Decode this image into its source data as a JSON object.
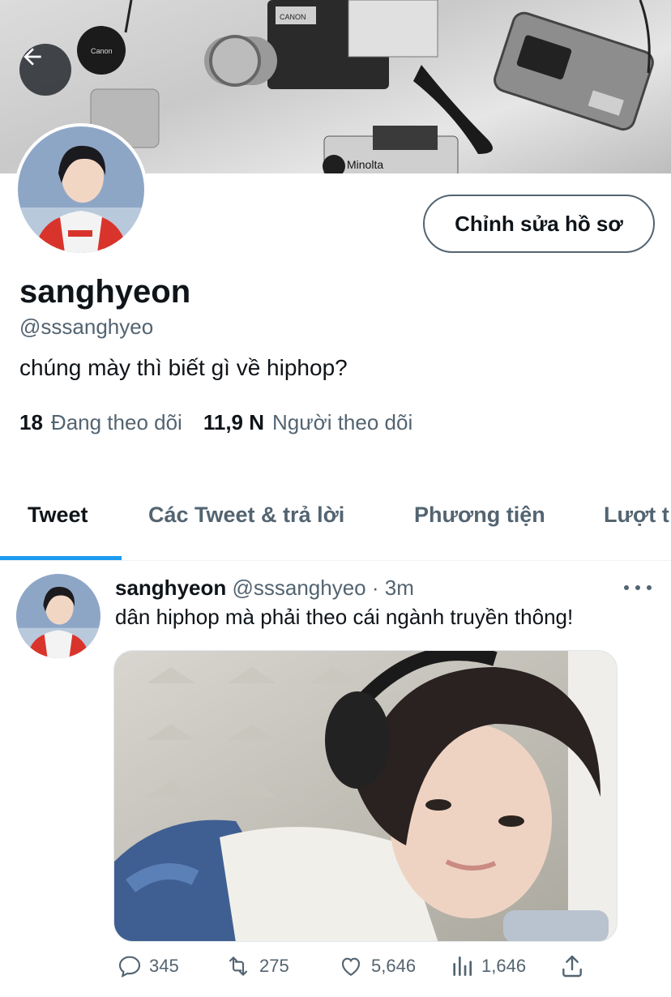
{
  "profile": {
    "display_name": "sanghyeon",
    "handle": "@sssanghyeo",
    "bio": "chúng mày thì biết gì về hiphop?",
    "edit_button_label": "Chỉnh sửa hồ sơ",
    "following_count": "18",
    "following_label": "Đang theo dõi",
    "followers_count": "11,9 N",
    "followers_label": "Người theo dõi"
  },
  "tabs": [
    {
      "label": "Tweet",
      "active": true
    },
    {
      "label": "Các Tweet & trả lời",
      "active": false
    },
    {
      "label": "Phương tiện",
      "active": false
    },
    {
      "label": "Lượt t",
      "active": false
    }
  ],
  "tweet": {
    "name": "sanghyeon",
    "handle": "@sssanghyeo",
    "separator": "·",
    "time": "3m",
    "text": "dân hiphop mà phải theo cái ngành truyền thông!",
    "replies": "345",
    "retweets": "275",
    "likes": "5,646",
    "views": "1,646"
  },
  "banner": {
    "camera_brands": [
      "Canon",
      "Minolta",
      "CANON"
    ]
  },
  "icons": {
    "back": "arrow-left-icon",
    "more": "more-horizontal-icon",
    "reply": "reply-icon",
    "retweet": "retweet-icon",
    "like": "heart-icon",
    "views": "views-icon",
    "share": "share-icon"
  },
  "colors": {
    "accent": "#1d9bf0",
    "text_primary": "#0f1419",
    "text_secondary": "#536471"
  }
}
